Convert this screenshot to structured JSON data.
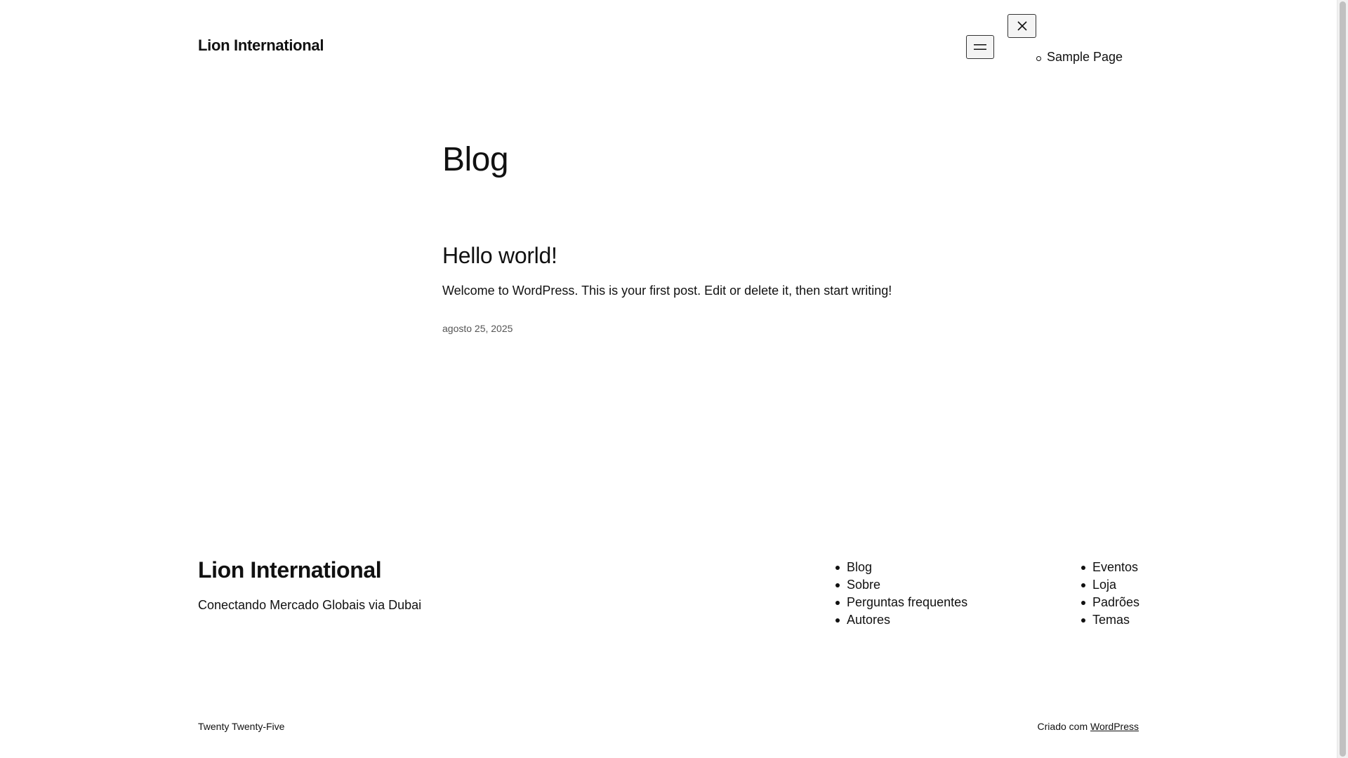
{
  "header": {
    "site_title": "Lion International",
    "open_menu_icon": "hamburger-menu-icon",
    "close_menu_icon": "close-icon",
    "overlay_nav": [
      {
        "label": "Sample Page"
      }
    ]
  },
  "main": {
    "page_title": "Blog",
    "posts": [
      {
        "title": "Hello world!",
        "excerpt": "Welcome to WordPress. This is your first post. Edit or delete it, then start writing!",
        "date": "agosto 25, 2025"
      }
    ]
  },
  "footer": {
    "site_title": "Lion International",
    "tagline": "Conectando Mercado Globais via Dubai",
    "nav_col1": [
      {
        "label": "Blog"
      },
      {
        "label": "Sobre"
      },
      {
        "label": "Perguntas frequentes"
      },
      {
        "label": "Autores"
      }
    ],
    "nav_col2": [
      {
        "label": "Eventos"
      },
      {
        "label": "Loja"
      },
      {
        "label": "Padrões"
      },
      {
        "label": "Temas"
      }
    ],
    "theme_credit": "Twenty Twenty-Five",
    "powered_prefix": "Criado com",
    "powered_link": "WordPress"
  }
}
